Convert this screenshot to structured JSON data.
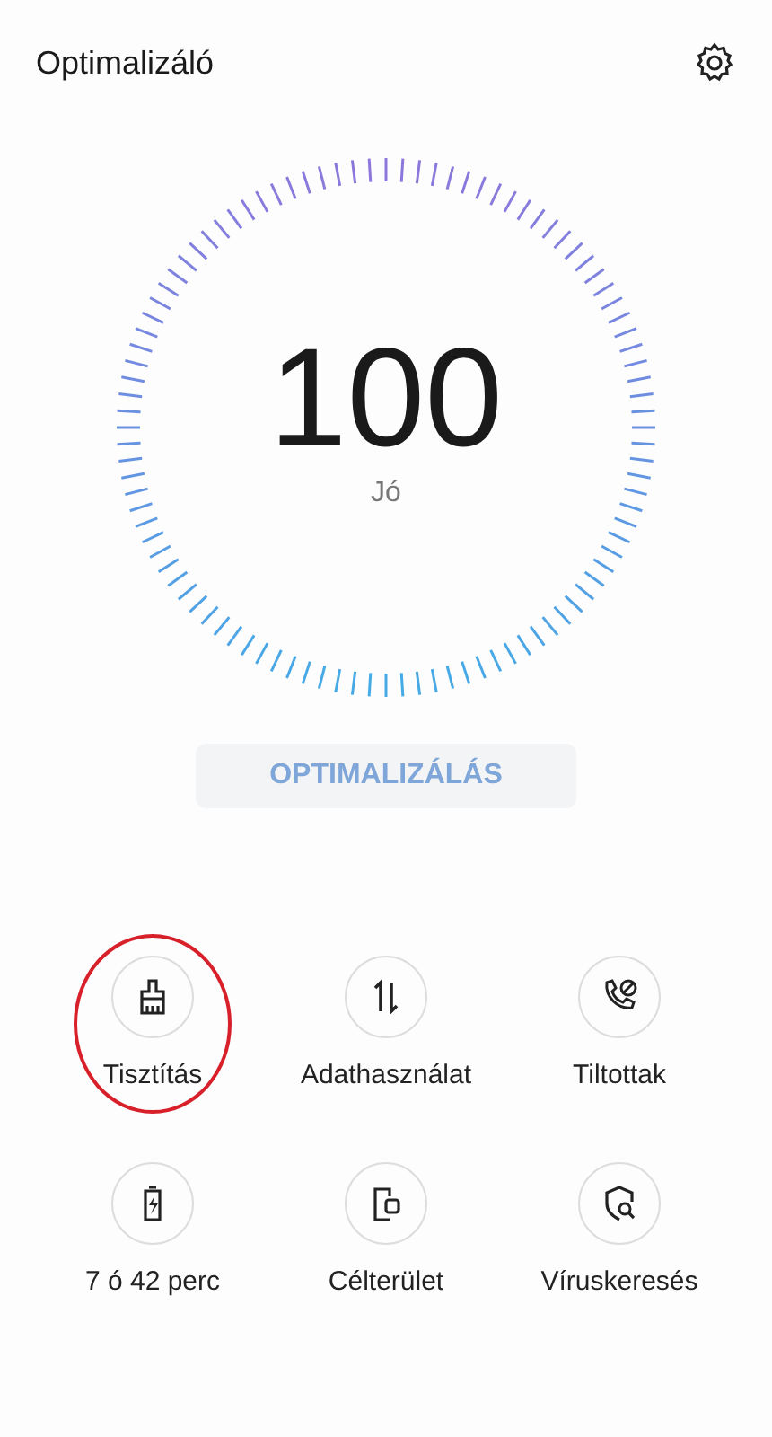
{
  "header": {
    "title": "Optimalizáló"
  },
  "score": {
    "value": "100",
    "rating": "Jó"
  },
  "optimize_button": {
    "label": "OPTIMALIZÁLÁS",
    "disabled": true
  },
  "tools": [
    {
      "kind": "broom",
      "label": "Tisztítás",
      "circled": true
    },
    {
      "kind": "data",
      "label": "Adathasználat",
      "circled": false
    },
    {
      "kind": "blocked",
      "label": "Tiltottak",
      "circled": false
    },
    {
      "kind": "battery",
      "label": "7 ó 42 perc",
      "circled": false
    },
    {
      "kind": "phone",
      "label": "Célterület",
      "circled": false
    },
    {
      "kind": "shield",
      "label": "Víruskeresés",
      "circled": false
    }
  ]
}
